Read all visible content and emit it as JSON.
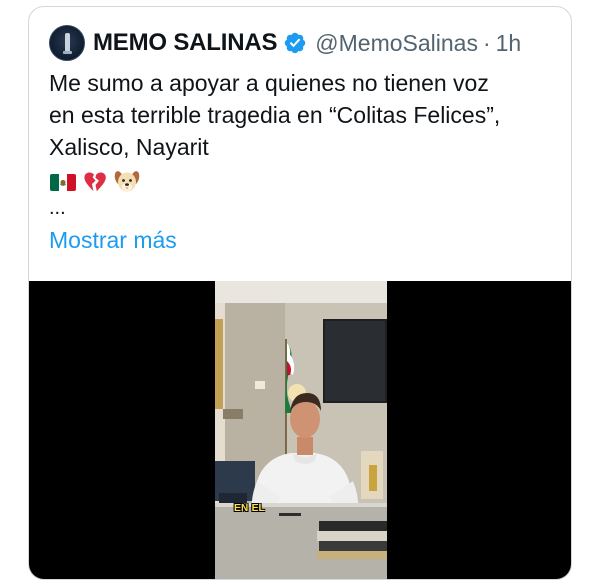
{
  "tweet": {
    "author_name": "MEMO SALINAS",
    "handle": "@MemoSalinas",
    "separator": "·",
    "time": "1h",
    "text_lines": [
      "Me sumo a apoyar a quienes no tienen voz",
      "en esta terrible tragedia en “Colitas Felices”,",
      "Xalisco, Nayarit"
    ],
    "emojis": [
      "mexico-flag-icon",
      "broken-heart-icon",
      "dog-face-icon"
    ],
    "ellipsis": "...",
    "show_more": "Mostrar más"
  },
  "video": {
    "caption": "EN EL"
  },
  "colors": {
    "text": "#0f1419",
    "secondary": "#536471",
    "link": "#1d9bf0",
    "verified": "#1d9bf0",
    "border": "#cfd9de"
  }
}
